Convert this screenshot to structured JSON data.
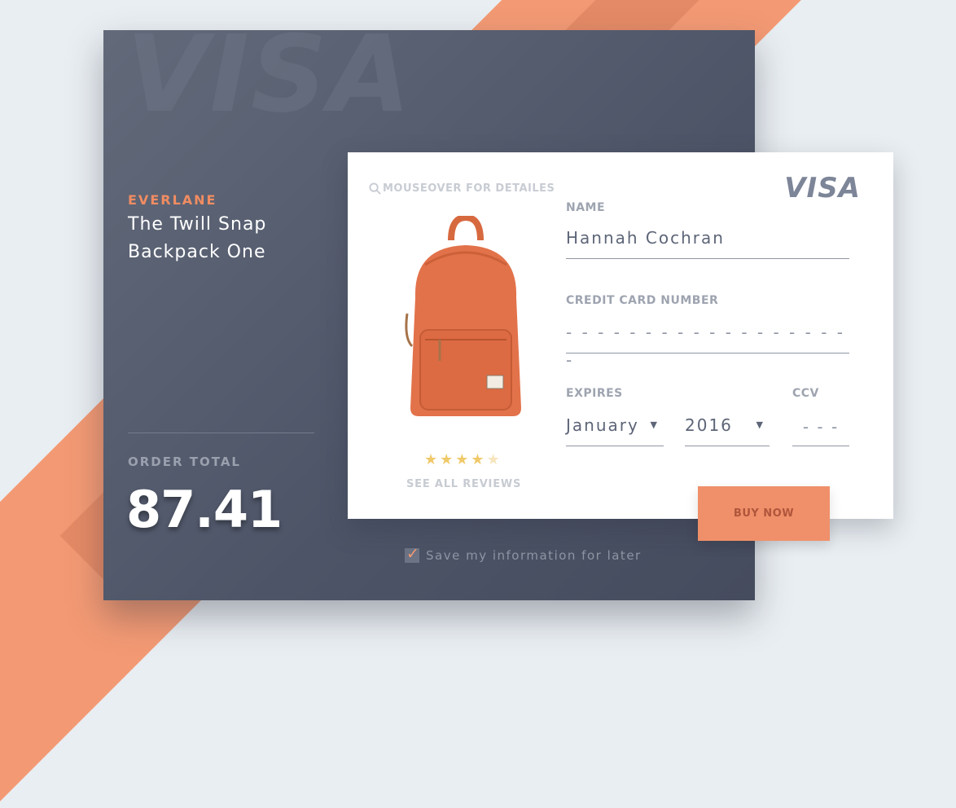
{
  "product": {
    "brand": "EVERLANE",
    "name": "The Twill Snap Backpack One"
  },
  "order": {
    "label": "ORDER TOTAL",
    "total": "87.41"
  },
  "watermark": "VISA",
  "card": {
    "visa_logo": "VISA",
    "mouseover_text": "MOUSEOVER FOR DETAILES",
    "rating": 4,
    "rating_max": 5,
    "reviews_link": "SEE ALL REVIEWS"
  },
  "form": {
    "name_label": "NAME",
    "name_value": "Hannah Cochran",
    "card_number_label": "CREDIT CARD NUMBER",
    "card_number_value": "- - - -  -  - - - -  -  - - - -  -  - - - -",
    "expires_label": "EXPIRES",
    "month_value": "January",
    "year_value": "2016",
    "ccv_label": "CCV",
    "ccv_value": "- - -",
    "buy_button": "BUY NOW",
    "save_label": "Save my information for later",
    "save_checked": true
  },
  "colors": {
    "accent": "#f0906a",
    "dark_panel": "#525a6c",
    "star": "#f0c96a"
  }
}
